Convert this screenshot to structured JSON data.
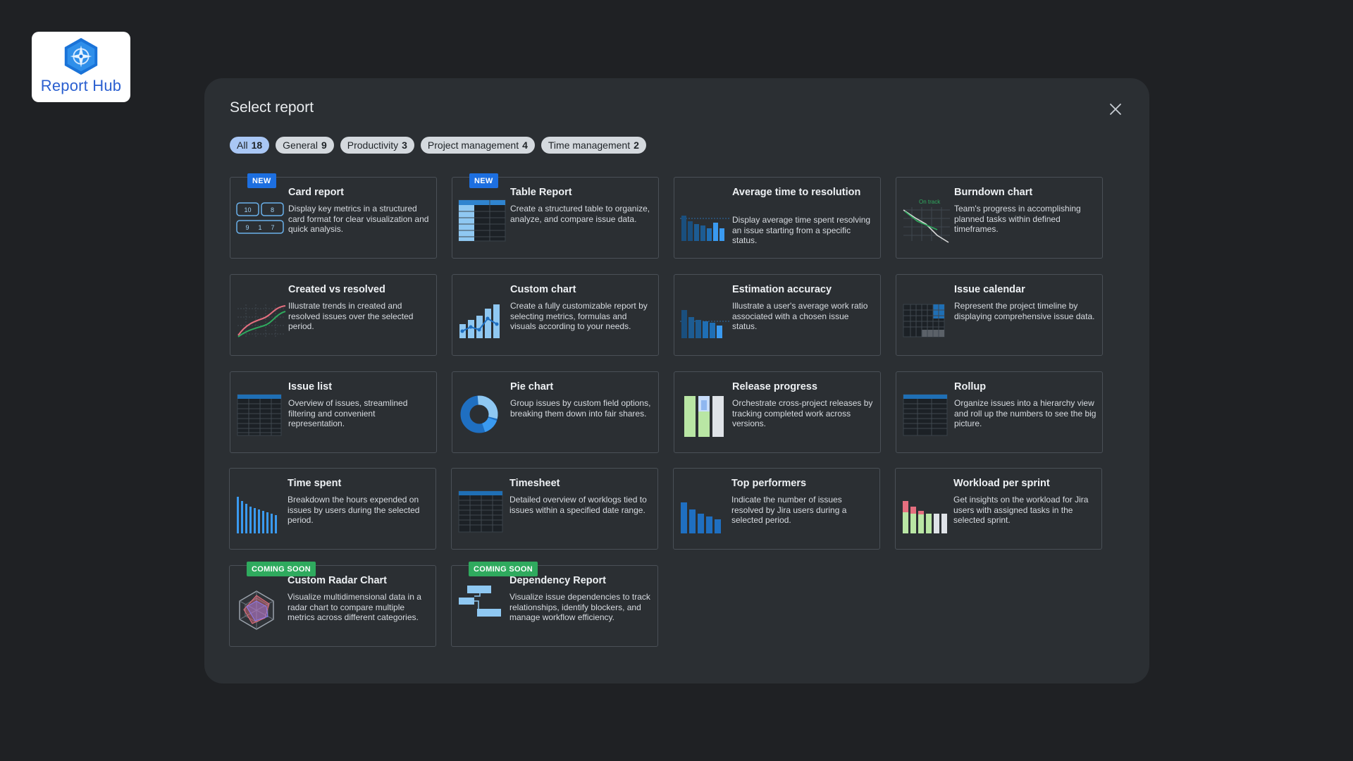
{
  "app": {
    "logo_text": "Report Hub"
  },
  "modal": {
    "title": "Select report"
  },
  "filters": [
    {
      "label": "All",
      "count": "18",
      "active": true
    },
    {
      "label": "General",
      "count": "9",
      "active": false
    },
    {
      "label": "Productivity",
      "count": "3",
      "active": false
    },
    {
      "label": "Project management",
      "count": "4",
      "active": false
    },
    {
      "label": "Time management",
      "count": "2",
      "active": false
    }
  ],
  "badges": {
    "new": "NEW",
    "soon": "COMING SOON"
  },
  "reports": [
    {
      "title": "Card report",
      "desc": "Display key metrics in a structured card format for clear visualization and quick analysis.",
      "badge": "new",
      "icon": "card-report-icon",
      "card_values": [
        "10",
        "8",
        "9",
        "1",
        "7"
      ]
    },
    {
      "title": "Table Report",
      "desc": "Create a structured table to organize, analyze, and compare issue data.",
      "badge": "new",
      "icon": "table-report-icon"
    },
    {
      "title": "Average time to resolution",
      "desc": "Display average time spent resolving an issue starting from a specific status.",
      "badge": null,
      "icon": "average-time-icon"
    },
    {
      "title": "Burndown chart",
      "desc": "Team's progress in accomplishing planned tasks within defined timeframes.",
      "badge": null,
      "icon": "burndown-icon",
      "thumb_label": "On track"
    },
    {
      "title": "Created vs resolved",
      "desc": "Illustrate trends in created and resolved issues over the selected period.",
      "badge": null,
      "icon": "created-vs-resolved-icon"
    },
    {
      "title": "Custom chart",
      "desc": "Create a fully customizable report by selecting metrics, formulas and visuals according to your needs.",
      "badge": null,
      "icon": "custom-chart-icon"
    },
    {
      "title": "Estimation accuracy",
      "desc": "Illustrate a user's average work ratio associated with a chosen issue status.",
      "badge": null,
      "icon": "estimation-accuracy-icon"
    },
    {
      "title": "Issue calendar",
      "desc": "Represent the project timeline by displaying comprehensive issue data.",
      "badge": null,
      "icon": "issue-calendar-icon"
    },
    {
      "title": "Issue list",
      "desc": "Overview of issues, streamlined filtering and convenient representation.",
      "badge": null,
      "icon": "issue-list-icon"
    },
    {
      "title": "Pie chart",
      "desc": "Group issues by custom field options, breaking them down into fair shares.",
      "badge": null,
      "icon": "pie-chart-icon"
    },
    {
      "title": "Release progress",
      "desc": "Orchestrate cross-project releases by tracking completed work across versions.",
      "badge": null,
      "icon": "release-progress-icon"
    },
    {
      "title": "Rollup",
      "desc": "Organize issues into a hierarchy view and roll up the numbers to see the big picture.",
      "badge": null,
      "icon": "rollup-icon"
    },
    {
      "title": "Time spent",
      "desc": "Breakdown the hours expended on issues by users during the selected period.",
      "badge": null,
      "icon": "time-spent-icon"
    },
    {
      "title": "Timesheet",
      "desc": "Detailed overview of worklogs tied to issues within a specified date range.",
      "badge": null,
      "icon": "timesheet-icon"
    },
    {
      "title": "Top performers",
      "desc": "Indicate the number of issues resolved by Jira users during a selected period.",
      "badge": null,
      "icon": "top-performers-icon"
    },
    {
      "title": "Workload per sprint",
      "desc": "Get insights on the workload for Jira users with assigned tasks in the selected sprint.",
      "badge": null,
      "icon": "workload-icon"
    },
    {
      "title": "Custom Radar Chart",
      "desc": "Visualize multidimensional data in a radar chart to compare multiple metrics across different categories.",
      "badge": "soon",
      "icon": "radar-chart-icon"
    },
    {
      "title": "Dependency Report",
      "desc": "Visualize issue dependencies to track relationships, identify blockers, and manage workflow efficiency.",
      "badge": "soon",
      "icon": "dependency-icon"
    }
  ],
  "colors": {
    "background": "#1f2124",
    "modal": "#2b2f33",
    "chip_active": "#a9c7f5",
    "chip": "#d4d9de",
    "badge_new": "#1d6fe0",
    "badge_soon": "#2faa5e",
    "accent_blue": "#1f6fc1",
    "light_blue": "#8fc8f2"
  }
}
